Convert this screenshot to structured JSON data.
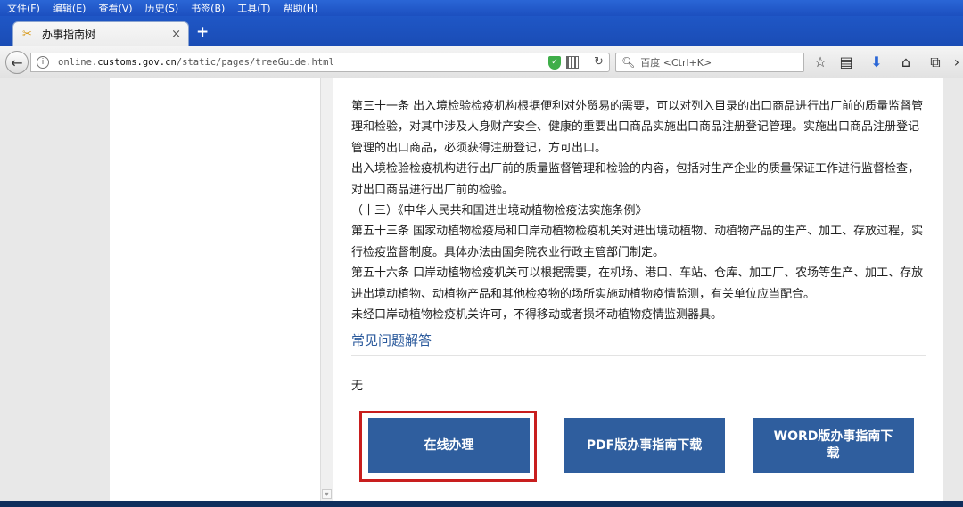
{
  "menu": [
    "文件(F)",
    "编辑(E)",
    "查看(V)",
    "历史(S)",
    "书签(B)",
    "工具(T)",
    "帮助(H)"
  ],
  "tab": {
    "title": "办事指南树",
    "close": "×",
    "new_tab": "+"
  },
  "address": {
    "url_prefix": "online.",
    "url_domain": "customs.gov.cn",
    "url_path": "/static/pages/treeGuide.html"
  },
  "search": {
    "placeholder": "百度 <Ctrl+K>"
  },
  "content": {
    "paragraphs": [
      "第三十一条 出入境检验检疫机构根据便利对外贸易的需要，可以对列入目录的出口商品进行出厂前的质量监督管理和检验，对其中涉及人身财产安全、健康的重要出口商品实施出口商品注册登记管理。实施出口商品注册登记管理的出口商品，必须获得注册登记，方可出口。",
      "出入境检验检疫机构进行出厂前的质量监督管理和检验的内容，包括对生产企业的质量保证工作进行监督检查，对出口商品进行出厂前的检验。",
      "（十三）《中华人民共和国进出境动植物检疫法实施条例》",
      "第五十三条 国家动植物检疫局和口岸动植物检疫机关对进出境动植物、动植物产品的生产、加工、存放过程，实行检疫监督制度。具体办法由国务院农业行政主管部门制定。",
      "第五十六条 口岸动植物检疫机关可以根据需要，在机场、港口、车站、仓库、加工厂、农场等生产、加工、存放进出境动植物、动植物产品和其他检疫物的场所实施动植物疫情监测，有关单位应当配合。",
      "未经口岸动植物检疫机关许可，不得移动或者损坏动植物疫情监测器具。"
    ],
    "faq_title": "常见问题解答",
    "faq_answer": "无"
  },
  "buttons": {
    "online": "在线办理",
    "pdf": "PDF版办事指南下载",
    "word": "WORD版办事指南下载"
  }
}
